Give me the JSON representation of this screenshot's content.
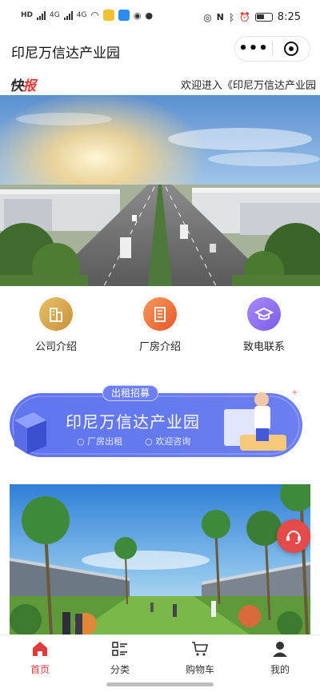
{
  "status": {
    "left_tags": [
      "HD",
      "4G",
      "4G"
    ],
    "time": "8:25"
  },
  "header": {
    "title": "印尼万信达产业园",
    "more_glyph": "•••"
  },
  "ticker": {
    "badge_prefix": "快",
    "badge_suffix": "报",
    "text": "欢迎进入《印尼万信达产业园"
  },
  "quick_nav": [
    {
      "label": "公司介绍",
      "icon": "building-icon",
      "color": "#d8a84a"
    },
    {
      "label": "厂房介绍",
      "icon": "factory-icon",
      "color": "#f07a3a"
    },
    {
      "label": "致电联系",
      "icon": "graduation-cap-icon",
      "color": "#8b6cf0"
    }
  ],
  "recruit": {
    "tag": "出租招募",
    "title": "印尼万信达产业园",
    "bullets": [
      "厂房出租",
      "欢迎咨询"
    ]
  },
  "tabs": [
    {
      "label": "首页",
      "icon": "home-icon",
      "active": true
    },
    {
      "label": "分类",
      "icon": "category-list-icon",
      "active": false
    },
    {
      "label": "购物车",
      "icon": "cart-icon",
      "active": false
    },
    {
      "label": "我的",
      "icon": "user-icon",
      "active": false
    }
  ],
  "colors": {
    "accent": "#e03a3a",
    "recruit_blue": "#4f63e8"
  }
}
